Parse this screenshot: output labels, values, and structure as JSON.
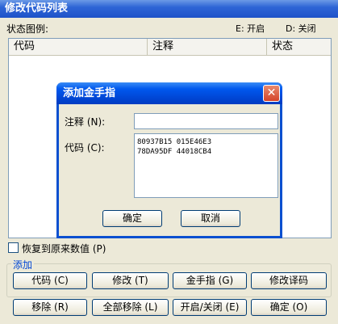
{
  "window": {
    "title": "修改代码列表",
    "legend_label": "状态图例:",
    "legend_on": "E: 开启",
    "legend_off": "D: 关闭"
  },
  "list": {
    "columns": [
      "代码",
      "注释",
      "状态"
    ]
  },
  "restore_checkbox": {
    "label": "恢复到原来数值 (P)",
    "checked": false
  },
  "group": {
    "title": "添加"
  },
  "buttons": {
    "code": "代码 (C)",
    "edit": "修改 (T)",
    "cheat": "金手指 (G)",
    "edit_code": "修改译码",
    "remove": "移除 (R)",
    "remove_all": "全部移除 (L)",
    "toggle": "开启/关闭 (E)",
    "ok": "确定 (O)"
  },
  "dialog": {
    "title": "添加金手指",
    "close_glyph": "✕",
    "note_label": "注释 (N):",
    "note_value": "",
    "code_label": "代码 (C):",
    "code_value": "80937B15 015E46E3\n78DA95DF 44018CB4",
    "ok_label": "确定",
    "cancel_label": "取消"
  }
}
